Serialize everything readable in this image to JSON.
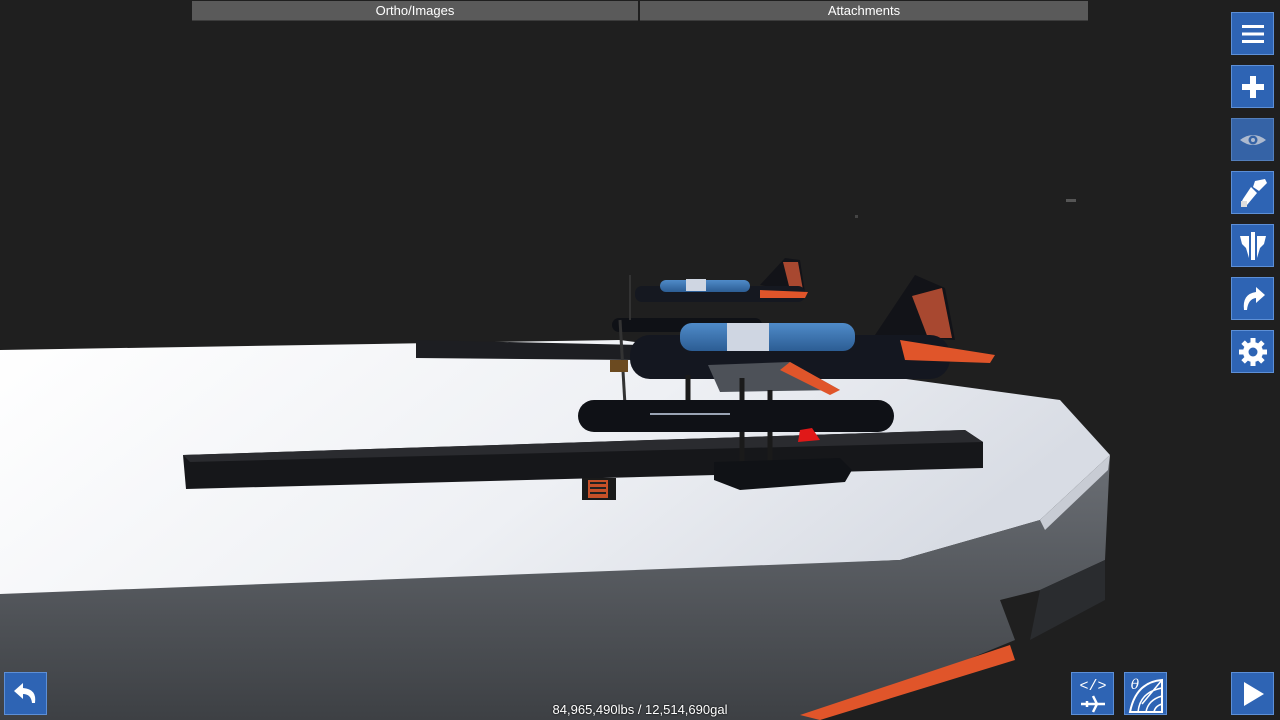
{
  "top_tabs": {
    "ortho_label": "Ortho/Images",
    "attachments_label": "Attachments"
  },
  "toolbar": {
    "buttons": [
      {
        "icon": "menu-icon"
      },
      {
        "icon": "add-part-icon"
      },
      {
        "icon": "view-eye-icon"
      },
      {
        "icon": "paint-brush-icon"
      },
      {
        "icon": "symmetry-icon"
      },
      {
        "icon": "redo-icon"
      },
      {
        "icon": "settings-gear-icon"
      }
    ]
  },
  "bottom_bar": {
    "undo_icon": "undo-icon",
    "code_icon": "xml-aircraft-icon",
    "theta_icon": "theta-radar-icon",
    "play_icon": "play-icon"
  },
  "status": {
    "mass_fuel": "84,965,490lbs / 12,514,690gal"
  },
  "colors": {
    "accent": "#2e64b4",
    "tab_bg": "#5a5a5a",
    "background": "#1f1f1f",
    "deck": "#f2f2f6",
    "hull_orange": "#e0552a"
  }
}
